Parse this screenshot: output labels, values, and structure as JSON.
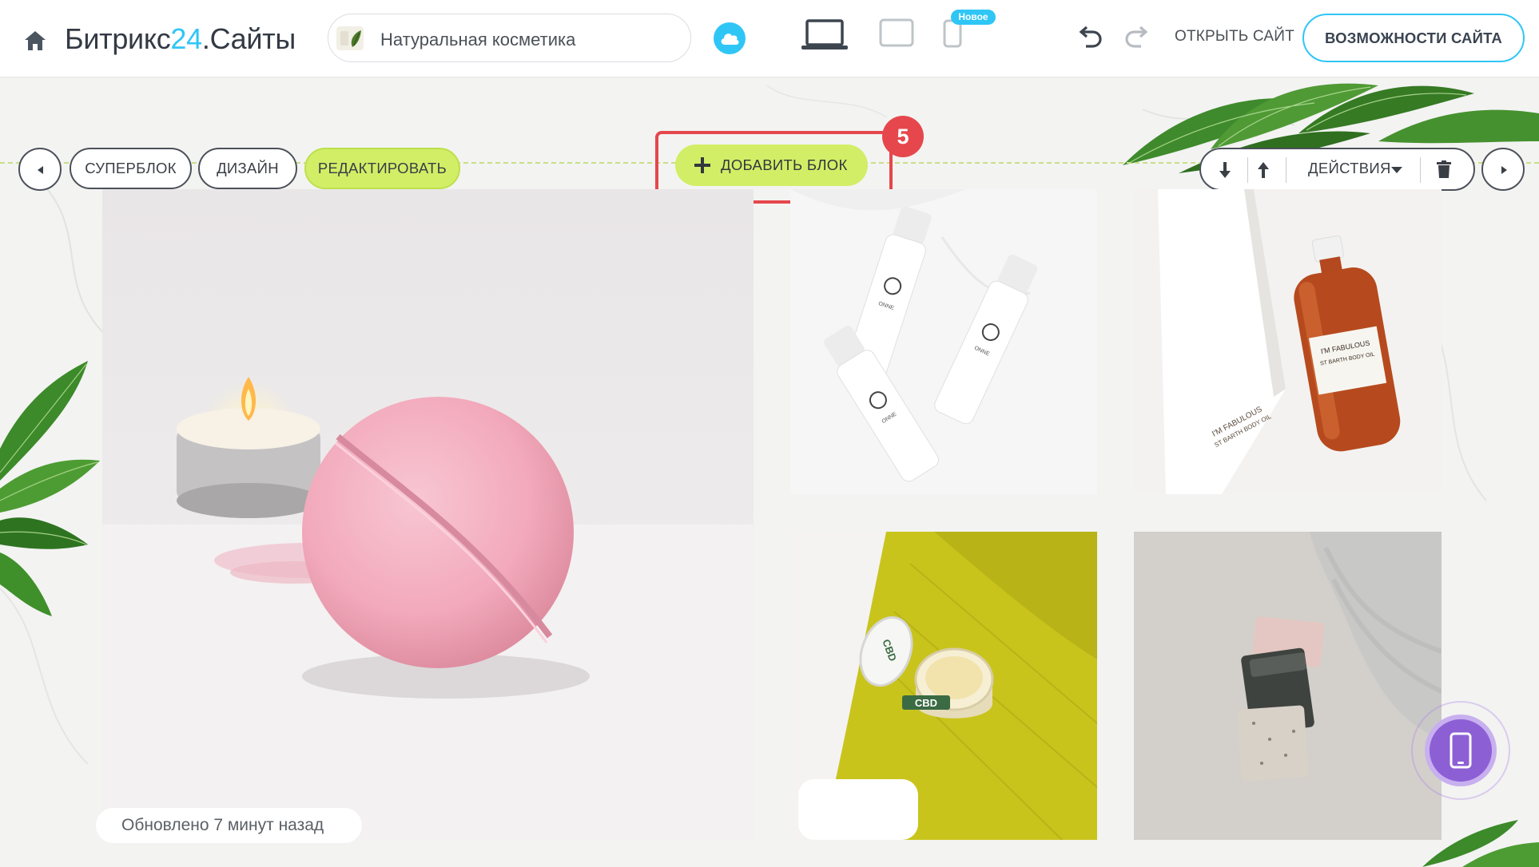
{
  "header": {
    "logo_main": "Битрикс",
    "logo_accent": "24",
    "logo_suffix": ".Сайты",
    "site_name": "Натуральная косметика",
    "badge_new": "Новое",
    "open_site": "ОТКРЫТЬ САЙТ",
    "features": "ВОЗМОЖНОСТИ САЙТА"
  },
  "block_toolbar": {
    "superblock": "СУПЕРБЛОК",
    "design": "ДИЗАЙН",
    "edit": "РЕДАКТИРОВАТЬ",
    "add_block": "ДОБАВИТЬ БЛОК",
    "actions": "ДЕЙСТВИЯ",
    "step_number": "5"
  },
  "status": {
    "updated": "Обновлено 7 минут назад"
  },
  "colors": {
    "accent_blue": "#2fc6f6",
    "lime": "#d2ee66",
    "highlight_red": "#e5474c",
    "fab_purple": "#8d5fd5"
  },
  "photo_labels": {
    "bottle_brand": "ONNE",
    "oil_label_1": "I'M FABULOUS",
    "oil_label_2": "ST BARTH BODY OIL",
    "jar_label": "CBD"
  }
}
